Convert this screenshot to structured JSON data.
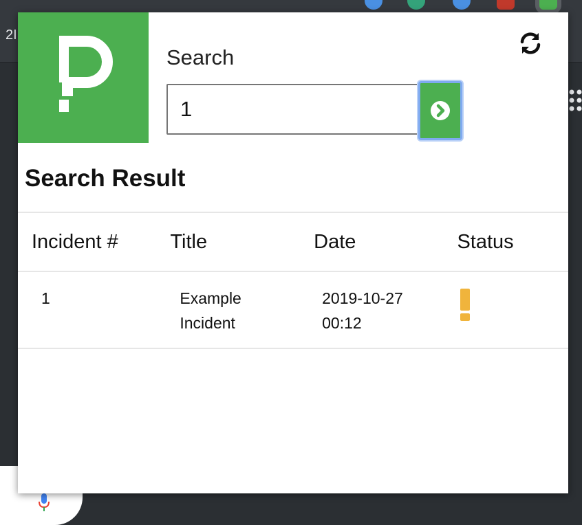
{
  "browser": {
    "tab_text": "2I"
  },
  "colors": {
    "brand_green": "#4caf50",
    "status_warning": "#f0b43c"
  },
  "search": {
    "label": "Search",
    "value": "1",
    "go_icon": "chevron-circle-right-icon",
    "refresh_icon": "refresh-icon"
  },
  "results": {
    "title": "Search Result",
    "columns": [
      "Incident #",
      "Title",
      "Date",
      "Status"
    ],
    "rows": [
      {
        "incident": "1",
        "title_line1": "Example",
        "title_line2": "Incident",
        "date_line1": "2019-10-27",
        "date_line2": "00:12",
        "status_icon": "exclamation-icon"
      }
    ]
  }
}
